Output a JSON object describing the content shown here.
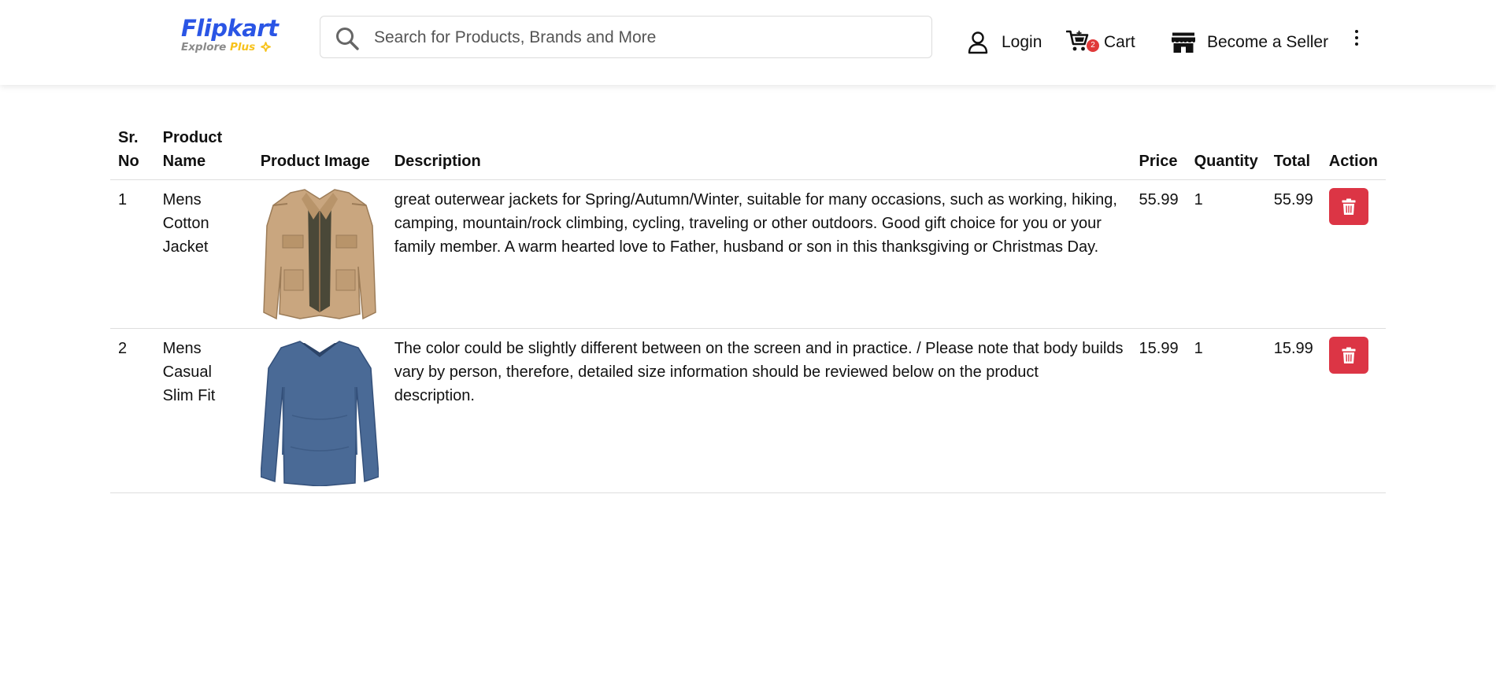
{
  "brand": {
    "name": "Flipkart",
    "sub_explore": "Explore",
    "sub_plus": "Plus"
  },
  "search": {
    "placeholder": "Search for Products, Brands and More",
    "value": ""
  },
  "nav": {
    "login": "Login",
    "cart": "Cart",
    "cart_count": "2",
    "seller": "Become a Seller"
  },
  "table": {
    "headers": {
      "sr_line1": "Sr.",
      "sr_line2": "No",
      "name_line1": "Product",
      "name_line2": "Name",
      "image": "Product Image",
      "description": "Description",
      "price": "Price",
      "quantity": "Quantity",
      "total": "Total",
      "action": "Action"
    },
    "rows": [
      {
        "sr": "1",
        "name": "Mens Cotton Jacket",
        "image_icon": "jacket-image",
        "description": "great outerwear jackets for Spring/Autumn/Winter, suitable for many occasions, such as working, hiking, camping, mountain/rock climbing, cycling, traveling or other outdoors. Good gift choice for you or your family member. A warm hearted love to Father, husband or son in this thanksgiving or Christmas Day.",
        "price": "55.99",
        "quantity": "1",
        "total": "55.99"
      },
      {
        "sr": "2",
        "name": "Mens Casual Slim Fit",
        "image_icon": "tshirt-image",
        "description": "The color could be slightly different between on the screen and in practice. / Please note that body builds vary by person, therefore, detailed size information should be reviewed below on the product description.",
        "price": "15.99",
        "quantity": "1",
        "total": "15.99"
      }
    ]
  },
  "colors": {
    "brand_blue": "#2a55e5",
    "plus_yellow": "#f7c21b",
    "delete_red": "#dc3545",
    "badge_red": "#e03a3a",
    "jacket_khaki": "#c8a57e",
    "shirt_blue": "#4a6a96"
  }
}
